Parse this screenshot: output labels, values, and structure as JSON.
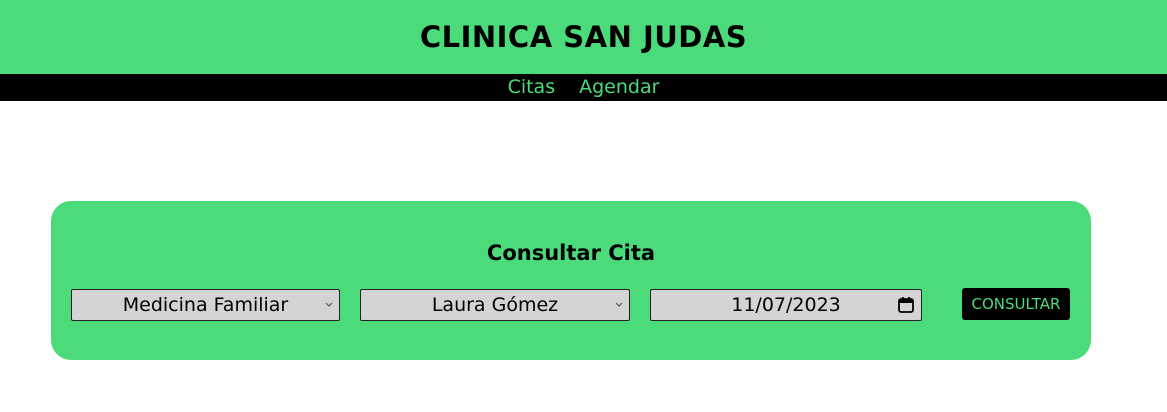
{
  "header": {
    "title": "CLINICA SAN JUDAS"
  },
  "nav": {
    "items": [
      {
        "label": "Citas"
      },
      {
        "label": "Agendar"
      }
    ]
  },
  "form": {
    "title": "Consultar Cita",
    "specialty": {
      "value": "Medicina Familiar",
      "icon": "chevron-down-icon"
    },
    "doctor": {
      "value": "Laura Gómez",
      "icon": "chevron-down-icon"
    },
    "date": {
      "value": "11/07/2023",
      "icon": "calendar-icon"
    },
    "submit_label": "CONSULTAR"
  },
  "colors": {
    "brand": "#4cdb7b",
    "nav_bg": "#000000",
    "field_bg": "#d4d4d4"
  }
}
